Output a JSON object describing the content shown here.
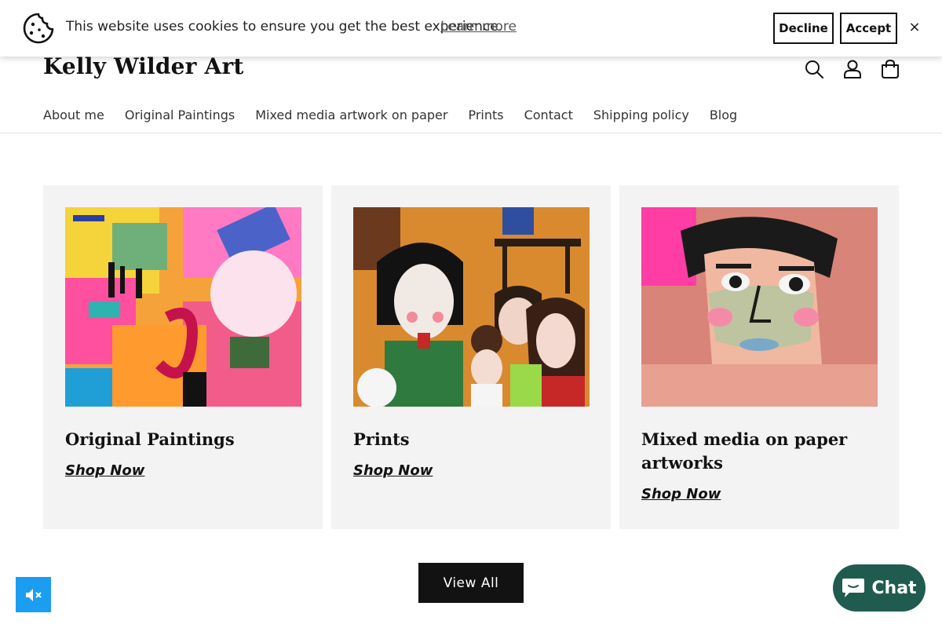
{
  "cookie_banner": {
    "message": "This website uses cookies to ensure you get the best experience.",
    "learn_more": "Learn more",
    "decline": "Decline",
    "accept": "Accept",
    "close": "×"
  },
  "header": {
    "logo": "Kelly Wilder Art",
    "icons": [
      "search-icon",
      "account-icon",
      "cart-icon"
    ],
    "nav": [
      "About me",
      "Original Paintings",
      "Mixed media artwork on paper",
      "Prints",
      "Contact",
      "Shipping policy",
      "Blog"
    ]
  },
  "collections": [
    {
      "title": "Original Paintings",
      "link": "Shop Now"
    },
    {
      "title": "Prints",
      "link": "Shop Now"
    },
    {
      "title": "Mixed media on paper artworks",
      "link": "Shop Now"
    }
  ],
  "view_all": "View All",
  "chat": {
    "label": "Chat",
    "color": "#1f5c4f"
  },
  "colors": {
    "accent": "#121212",
    "audio_button": "#1b9df0",
    "card_bg": "#f3f3f3"
  }
}
